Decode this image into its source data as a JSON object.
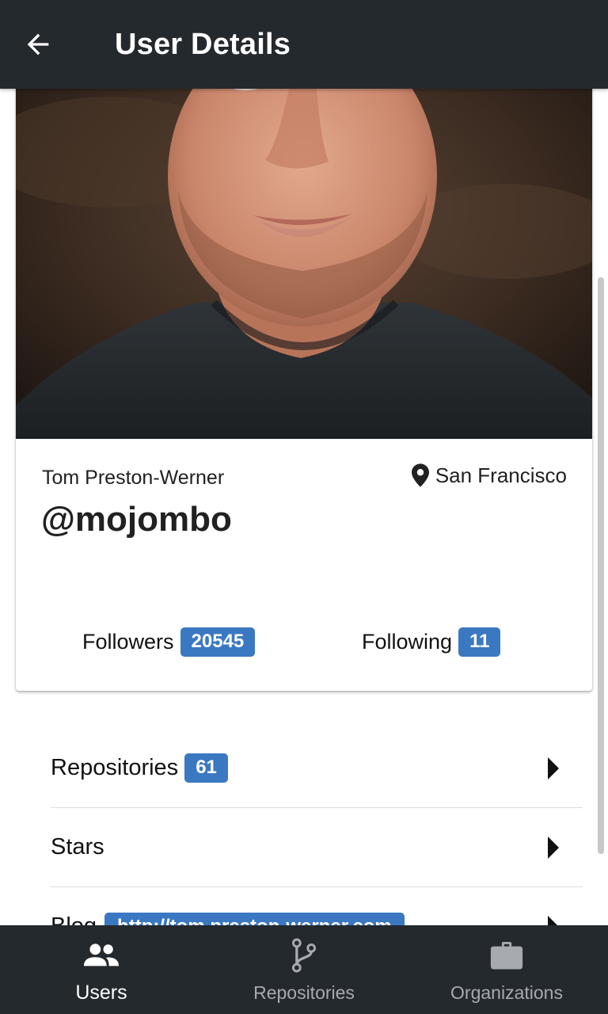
{
  "appbar": {
    "title": "User Details",
    "back_icon": "arrow-left-icon"
  },
  "profile": {
    "full_name": "Tom Preston-Werner",
    "location": "San Francisco",
    "location_icon": "map-pin-icon",
    "username": "@mojombo",
    "followers_label": "Followers",
    "followers_count": "20545",
    "following_label": "Following",
    "following_count": "11"
  },
  "list": [
    {
      "label": "Repositories",
      "badge": "61"
    },
    {
      "label": "Stars"
    },
    {
      "label": "Blog",
      "badge": "http://tom.preston-werner.com"
    }
  ],
  "bottom_nav": [
    {
      "label": "Users",
      "icon": "people-icon",
      "active": true
    },
    {
      "label": "Repositories",
      "icon": "git-branch-icon",
      "active": false
    },
    {
      "label": "Organizations",
      "icon": "briefcase-icon",
      "active": false
    }
  ],
  "colors": {
    "bar": "#24292e",
    "accent": "#3b78c2"
  }
}
